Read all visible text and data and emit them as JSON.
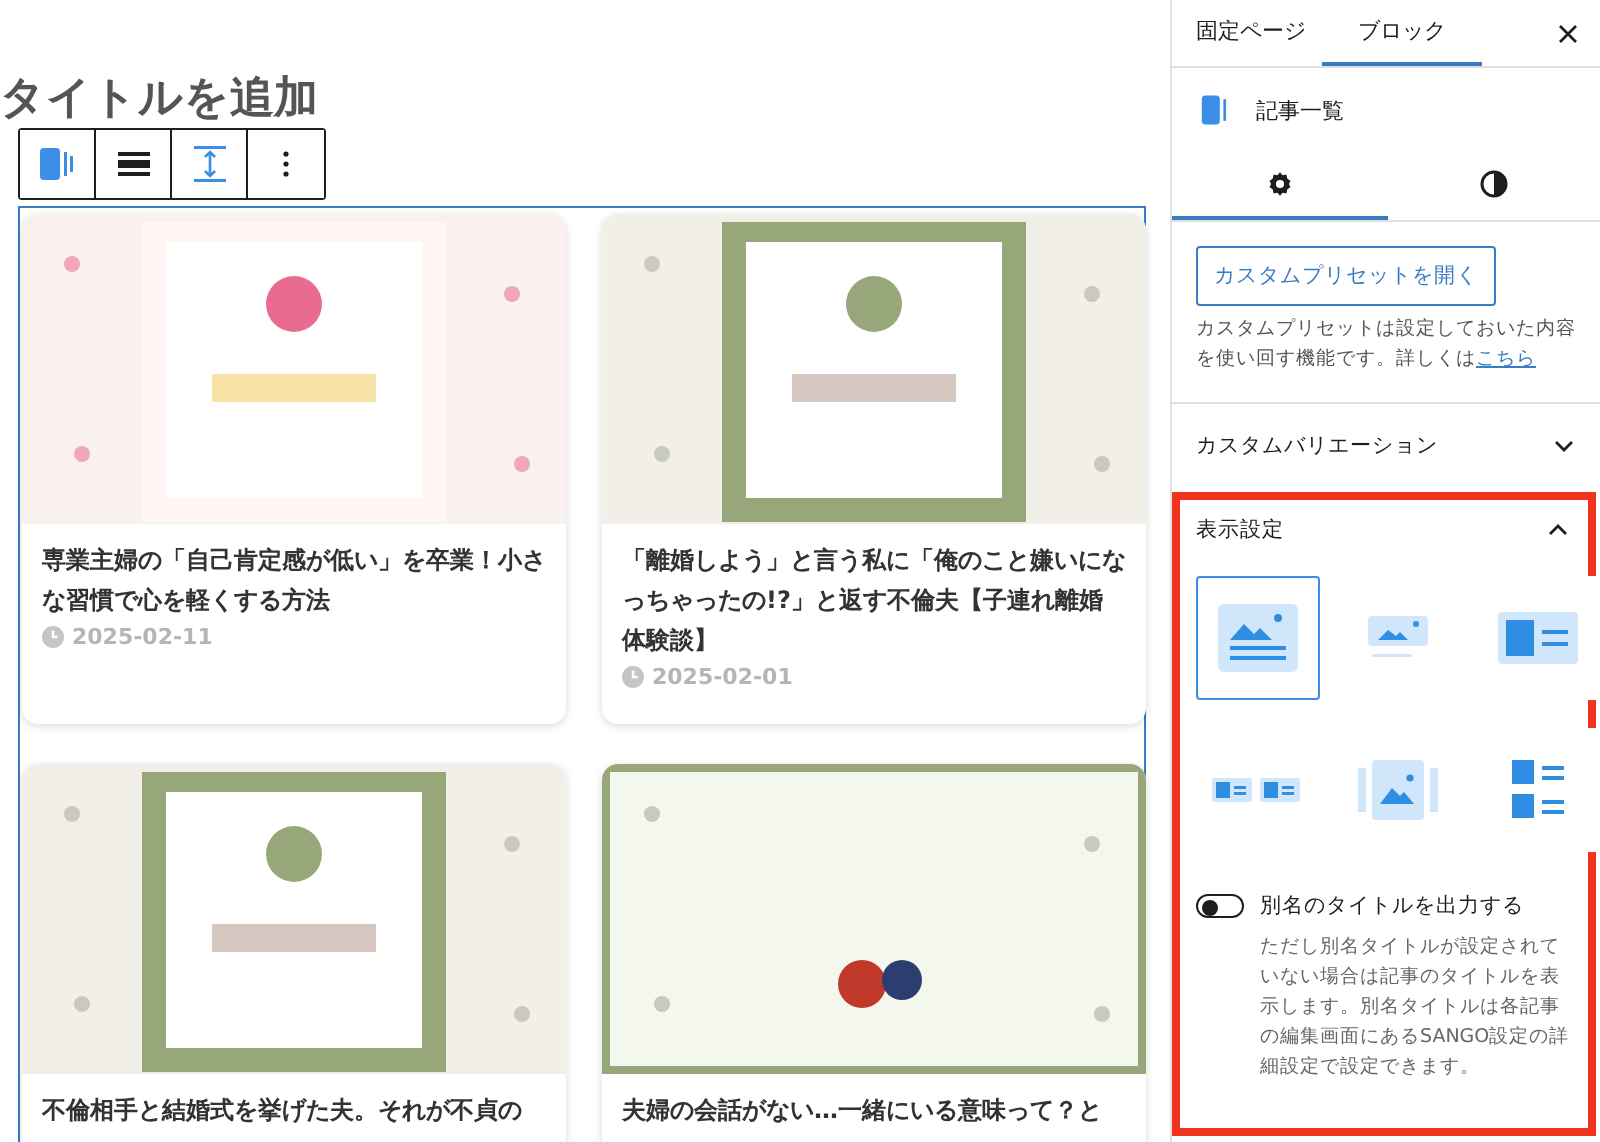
{
  "editor": {
    "title_placeholder": "タイトルを追加",
    "toolbar": [
      {
        "kind": "block"
      },
      {
        "kind": "align"
      },
      {
        "kind": "height"
      },
      {
        "kind": "more"
      }
    ],
    "cards": [
      {
        "title": "専業主婦の「自己肯定感が低い」を卒業！小さな習慣で心を軽くする方法",
        "date": "2025-02-11"
      },
      {
        "title": "「離婚しよう」と言う私に「俺のこと嫌いになっちゃったの!?」と返す不倫夫【子連れ離婚体験談】",
        "date": "2025-02-01"
      },
      {
        "title": "不倫相手と結婚式を挙げた夫。それが不貞の"
      },
      {
        "title": "夫婦の会話がない…一緒にいる意味って？と"
      }
    ]
  },
  "sidebar": {
    "tabs": [
      {
        "label": "固定ページ",
        "selected": false
      },
      {
        "label": "ブロック",
        "selected": true
      }
    ],
    "block_name": "記事一覧",
    "setting_tabs": [
      {
        "kind": "settings",
        "selected": true
      },
      {
        "kind": "styles",
        "selected": false
      }
    ],
    "preset_button": "カスタムプリセットを開く",
    "description": {
      "text": "カスタムプリセットは設定しておいた内容を使い回す機能です。詳しくは",
      "link": "こちら"
    },
    "variation_panel": {
      "title": "カスタムバリエーション",
      "expanded": false
    },
    "display_panel": {
      "title": "表示設定",
      "expanded": true,
      "highlighted": true,
      "layouts": [
        {
          "kind": "card",
          "selected": true
        },
        {
          "kind": "small-card",
          "selected": false
        },
        {
          "kind": "list",
          "selected": false
        },
        {
          "kind": "mini-list",
          "selected": false
        },
        {
          "kind": "slider",
          "selected": false
        },
        {
          "kind": "stacked-list",
          "selected": false
        }
      ],
      "toggle": {
        "label": "別名のタイトルを出力する",
        "on": false
      },
      "help": "ただし別名タイトルが設定されていない場合は記事のタイトルを表示します。別名タイトルは各記事の編集画面にあるSANGO設定の詳細設定で設定できます。"
    }
  }
}
